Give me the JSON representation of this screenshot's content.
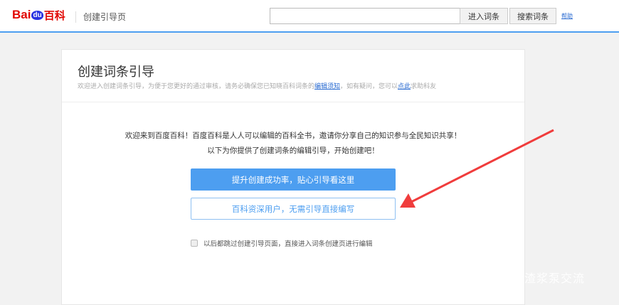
{
  "header": {
    "logo": {
      "bai": "Bai",
      "du": "du",
      "baike": "百科"
    },
    "page_title": "创建引导页",
    "search_value": "",
    "enter_entry": "进入词条",
    "search_entry": "搜索词条",
    "help": "帮助"
  },
  "card": {
    "title": "创建词条引导",
    "subtitle_pre": "欢迎进入创建词条引导，为便于您更好的通过审核，请务必确保您已知晓百科词条的",
    "subtitle_link1": "编辑须知",
    "subtitle_mid": "，如有疑问，您可以",
    "subtitle_link2": "点此",
    "subtitle_post": "求助科友",
    "intro1": "欢迎来到百度百科！百度百科是人人可以编辑的百科全书，邀请你分享自己的知识参与全民知识共享！",
    "intro2": "以下为你提供了创建词条的编辑引导，开始创建吧！",
    "primary_button": "提升创建成功率，贴心引导看这里",
    "secondary_button": "百科资深用户，无需引导直接编写",
    "skip_checkbox": "以后都跳过创建引导页面，直接进入词条创建页进行编辑",
    "skip_checked": false
  },
  "watermark": "渣浆泵交流",
  "colors": {
    "accent": "#4d9ef0",
    "logo_red": "#e10601",
    "arrow": "#f03c3c"
  }
}
